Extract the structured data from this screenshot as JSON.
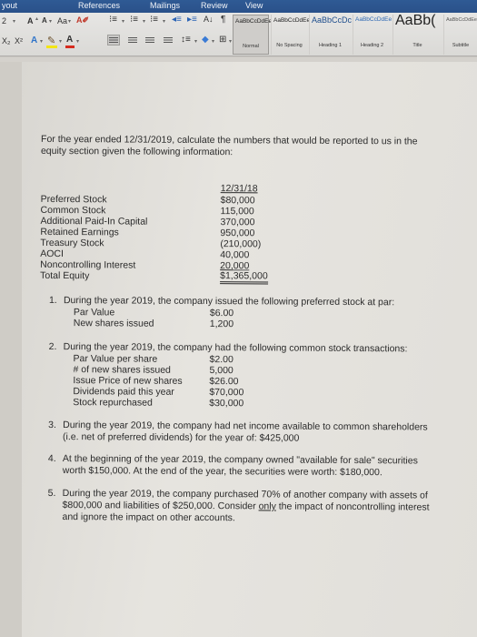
{
  "ribbon": {
    "tabs": [
      "yout",
      "References",
      "Mailings",
      "Review",
      "View"
    ],
    "font_size": "2",
    "font_grow": "A",
    "font_shrink": "A",
    "change_case": "Aa",
    "subscript": "X₂",
    "superscript": "X²",
    "highlight": "A",
    "font_color": "A",
    "sort": "A↓",
    "pilcrow": "¶",
    "styles": [
      {
        "sample": "AaBbCcDdEe",
        "name": "Normal"
      },
      {
        "sample": "AaBbCcDdEe",
        "name": "No Spacing"
      },
      {
        "sample": "AaBbCcDc",
        "name": "Heading 1"
      },
      {
        "sample": "AaBbCcDdEe",
        "name": "Heading 2"
      },
      {
        "sample": "AaBb(",
        "name": "Title"
      },
      {
        "sample": "AaBbCcDdEe",
        "name": "Subtitle"
      }
    ]
  },
  "document": {
    "intro_line1": "For the year ended 12/31/2019, calculate the numbers that would be reported to us in the",
    "intro_line2": "equity section given the following information:",
    "equity_header": "12/31/18",
    "equity_rows": [
      {
        "label": "Preferred Stock",
        "value": "$80,000"
      },
      {
        "label": "Common Stock",
        "value": "115,000"
      },
      {
        "label": "Additional Paid-In Capital",
        "value": "370,000"
      },
      {
        "label": "Retained Earnings",
        "value": "950,000"
      },
      {
        "label": "Treasury Stock",
        "value": "(210,000)"
      },
      {
        "label": "AOCI",
        "value": "40,000"
      },
      {
        "label": "Noncontrolling Interest",
        "value": "20,000"
      },
      {
        "label": "Total Equity",
        "value": "$1,365,000"
      }
    ],
    "item1": {
      "number": "1.",
      "text": "During the year 2019, the company issued the following preferred stock at par:",
      "rows": [
        {
          "label": "Par Value",
          "value": "$6.00"
        },
        {
          "label": "New shares issued",
          "value": "1,200"
        }
      ]
    },
    "item2": {
      "number": "2.",
      "text": "During the year 2019, the company had the following common stock transactions:",
      "rows": [
        {
          "label": "Par Value per share",
          "value": "$2.00"
        },
        {
          "label": "# of new shares issued",
          "value": "5,000"
        },
        {
          "label": "Issue Price of new shares",
          "value": "$26.00"
        },
        {
          "label": "Dividends paid this year",
          "value": "$70,000"
        },
        {
          "label": "Stock repurchased",
          "value": "$30,000"
        }
      ]
    },
    "item3": {
      "number": "3.",
      "line1": "During the year 2019, the company had net income available to common shareholders",
      "line2": "(i.e. net of preferred dividends) for the year of: $425,000"
    },
    "item4": {
      "number": "4.",
      "line1": "At the beginning of the year 2019, the company owned \"available for sale\" securities",
      "line2": "worth $150,000. At the end of the year, the securities were worth: $180,000."
    },
    "item5": {
      "number": "5.",
      "line1": "During the year 2019, the company purchased 70% of another company with assets of",
      "line2_a": "$800,000 and liabilities of $250,000. Consider ",
      "line2_only": "only",
      "line2_b": " the impact of noncontrolling interest",
      "line3": "and ignore the impact on other accounts."
    }
  }
}
